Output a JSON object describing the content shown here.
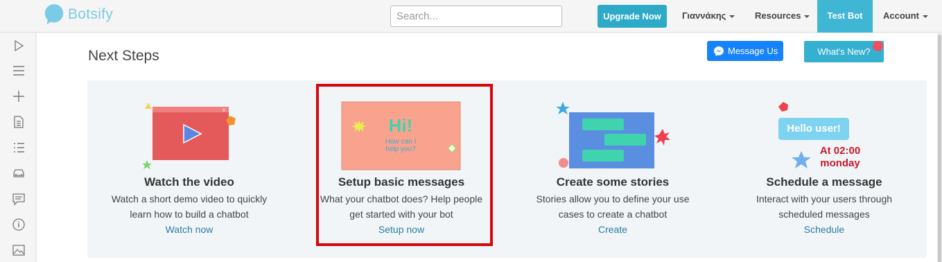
{
  "nav": {
    "logo_text": "Botsify",
    "search_placeholder": "Search...",
    "upgrade_label": "Upgrade Now",
    "user_label": "Γιαννάκης",
    "resources_label": "Resources",
    "testbot_label": "Test Bot",
    "account_label": "Account"
  },
  "sidebar": {
    "icons": [
      "play-icon",
      "menu-icon",
      "plus-icon",
      "document-icon",
      "list-icon",
      "car-icon",
      "comment-icon",
      "info-icon",
      "image-icon"
    ]
  },
  "main": {
    "title": "Next Steps",
    "message_us_label": "Message Us",
    "whats_new_label": "What's New?"
  },
  "cards": [
    {
      "title": "Watch the video",
      "desc_line1": "Watch a short demo video to quickly",
      "desc_line2": "learn how to build a chatbot",
      "link": "Watch now"
    },
    {
      "title": "Setup basic messages",
      "desc_line1": "What your chatbot does? Help people",
      "desc_line2": "get started with your bot",
      "link": "Setup now",
      "illus_hi": "Hi!",
      "illus_sub1": "How can I",
      "illus_sub2": "help you?"
    },
    {
      "title": "Create some stories",
      "desc_line1": "Stories allow you to define your use",
      "desc_line2": "cases to create a chatbot",
      "link": "Create"
    },
    {
      "title": "Schedule a message",
      "desc_line1": "Interact with your users through",
      "desc_line2": "scheduled messages",
      "link": "Schedule",
      "illus_bubble": "Hello user!",
      "illus_time": "At 02:00",
      "illus_day": "monday"
    }
  ],
  "colors": {
    "accent": "#36b0d0",
    "messenger": "#1683fb",
    "highlight": "#d6060b",
    "link": "#2a7ea1"
  }
}
